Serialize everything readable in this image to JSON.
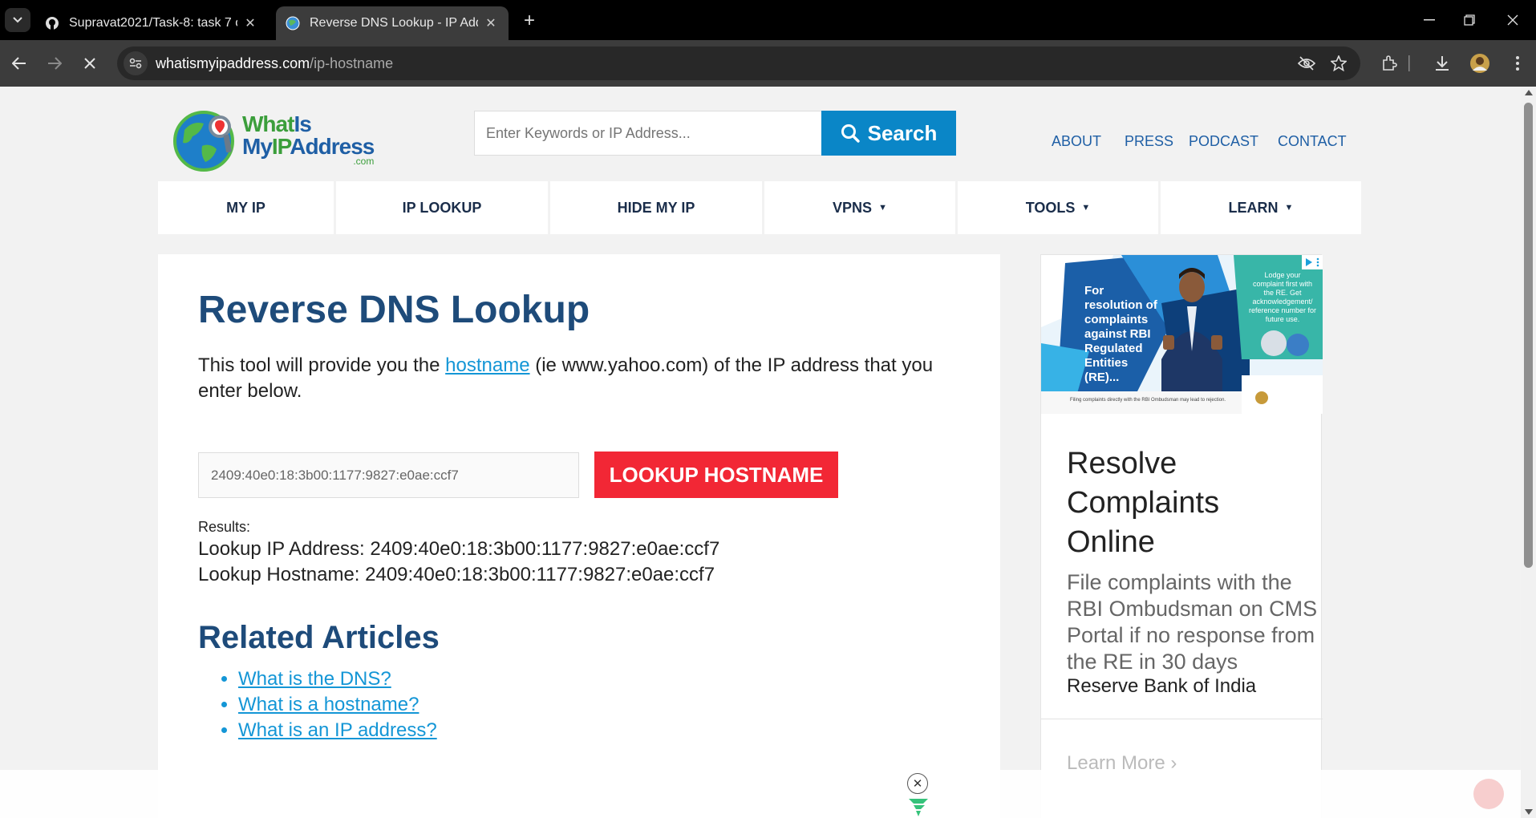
{
  "browser": {
    "tabs": [
      {
        "title": "Supravat2021/Task-8: task 7 of i",
        "active": false,
        "icon": "github-icon"
      },
      {
        "title": "Reverse DNS Lookup - IP Addre",
        "active": true,
        "icon": "globe-icon"
      }
    ],
    "url_domain": "whatismyipaddress.com",
    "url_path": "/ip-hostname"
  },
  "header": {
    "logo": {
      "line1_a": "What",
      "line1_b": "Is",
      "line2_a": "My",
      "line2_b": "IP",
      "line2_c": "Address",
      "line3": ".com"
    },
    "search_placeholder": "Enter Keywords or IP Address...",
    "search_button": "Search",
    "top_links": [
      "ABOUT",
      "PRESS",
      "PODCAST",
      "CONTACT"
    ]
  },
  "nav": [
    {
      "label": "MY IP",
      "dropdown": false
    },
    {
      "label": "IP LOOKUP",
      "dropdown": false
    },
    {
      "label": "HIDE MY IP",
      "dropdown": false
    },
    {
      "label": "VPNS",
      "dropdown": true
    },
    {
      "label": "TOOLS",
      "dropdown": true
    },
    {
      "label": "LEARN",
      "dropdown": true
    }
  ],
  "main": {
    "title": "Reverse DNS Lookup",
    "intro_before": "This tool will provide you the ",
    "intro_link": "hostname",
    "intro_after": " (ie www.yahoo.com) of the IP address that you enter below.",
    "ip_value": "2409:40e0:18:3b00:1177:9827:e0ae:ccf7",
    "lookup_button": "LOOKUP HOSTNAME",
    "results_label": "Results:",
    "result_ip": "Lookup IP Address: 2409:40e0:18:3b00:1177:9827:e0ae:ccf7",
    "result_host": "Lookup Hostname: 2409:40e0:18:3b00:1177:9827:e0ae:ccf7",
    "related_title": "Related Articles",
    "related": [
      "What is the DNS?",
      "What is a hostname?",
      "What is an IP address?"
    ]
  },
  "ad": {
    "banner_headline": "For resolution of complaints against RBI Regulated Entities (RE)...",
    "banner_side": "Lodge your complaint first with the RE. Get acknowledgement/ reference number for future use.",
    "banner_footer": "Filing complaints directly with the RBI Ombudsman may lead to rejection.",
    "title": "Resolve Complaints Online",
    "desc": "File complaints with the RBI Ombudsman on CMS Portal if no response from the RE in 30 days",
    "brand": "Reserve Bank of India",
    "cta": "Learn More"
  },
  "colors": {
    "accent_blue": "#0a86c7",
    "heading_blue": "#1e4b7a",
    "lookup_red": "#f22735",
    "link_blue": "#1496d6"
  }
}
